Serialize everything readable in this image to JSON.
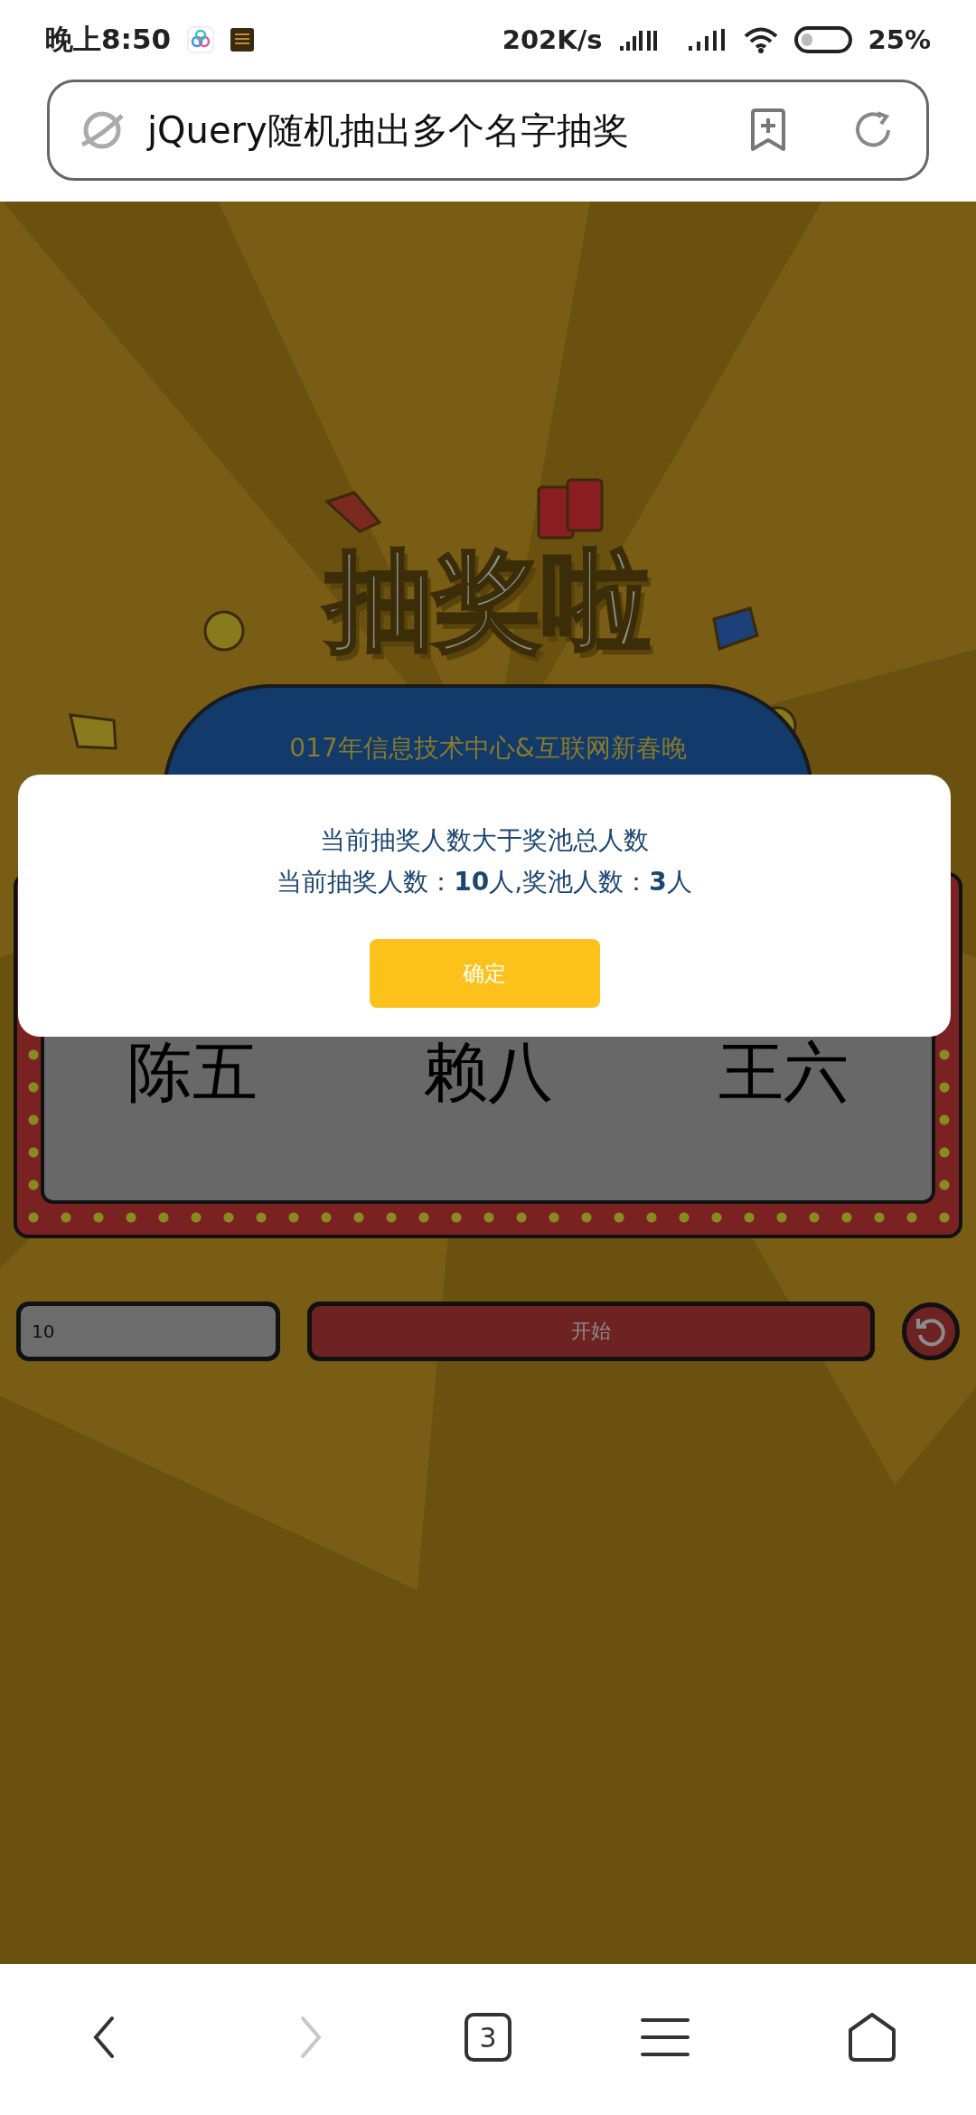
{
  "status_bar": {
    "time": "晚上8:50",
    "net_speed": "202K/s",
    "battery": "25%"
  },
  "address_bar": {
    "title": "jQuery随机抽出多个名字抽奖"
  },
  "page": {
    "title": "抽奖啦",
    "banner": "017年信息技术中心&互联网新春晚",
    "names": [
      "陈五",
      "赖八",
      "王六"
    ],
    "count_input": {
      "value": "10"
    },
    "start_button": "开始"
  },
  "dialog": {
    "message": "当前抽奖人数大于奖池总人数",
    "detail": "当前抽奖人数：**10**人,奖池人数：**3**人",
    "confirm": "确定"
  },
  "bottom_nav": [
    {
      "kind": "back",
      "disabled": false
    },
    {
      "kind": "forward",
      "disabled": true
    },
    {
      "kind": "tabs",
      "label": "3"
    },
    {
      "kind": "menu"
    },
    {
      "kind": "home"
    }
  ]
}
